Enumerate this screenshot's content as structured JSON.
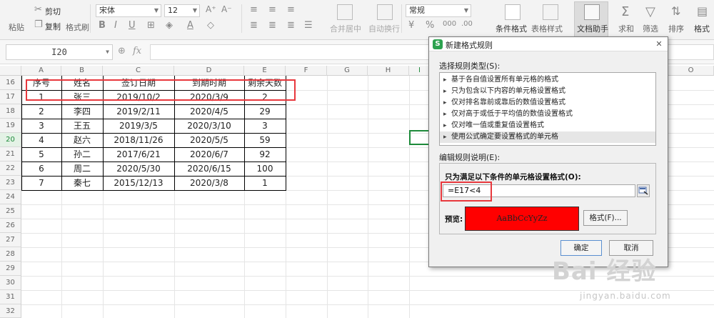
{
  "ribbon": {
    "paste": "粘贴",
    "cut": "剪切",
    "copy": "复制",
    "format_painter": "格式刷",
    "font_name": "宋体",
    "font_size": "12",
    "merge_center": "合并居中",
    "auto_wrap": "自动换行",
    "number_format": "常规",
    "conditional_format": "条件格式",
    "table_style": "表格样式",
    "doc_assistant": "文档助手",
    "sum": "求和",
    "filter": "筛选",
    "sort": "排序",
    "format": "格式"
  },
  "formula_bar": {
    "cell_ref": "I20",
    "fx": "fx"
  },
  "columns": [
    "A",
    "B",
    "C",
    "D",
    "E",
    "F",
    "G",
    "H",
    "I",
    "O"
  ],
  "rows": [
    "16",
    "17",
    "18",
    "19",
    "20",
    "21",
    "22",
    "23",
    "24",
    "25",
    "26",
    "27",
    "28",
    "29",
    "30",
    "31",
    "32",
    "33",
    "34",
    "35"
  ],
  "table": {
    "headers": [
      "序号",
      "姓名",
      "签订日期",
      "到期时期",
      "剩余天数"
    ],
    "data": [
      [
        "1",
        "张三",
        "2019/10/2",
        "2020/3/9",
        "2"
      ],
      [
        "2",
        "李四",
        "2019/2/11",
        "2020/4/5",
        "29"
      ],
      [
        "3",
        "王五",
        "2019/3/5",
        "2020/3/10",
        "3"
      ],
      [
        "4",
        "赵六",
        "2018/11/26",
        "2020/5/5",
        "59"
      ],
      [
        "5",
        "孙二",
        "2017/6/21",
        "2020/6/7",
        "92"
      ],
      [
        "6",
        "周二",
        "2020/5/30",
        "2020/6/15",
        "100"
      ],
      [
        "7",
        "秦七",
        "2015/12/13",
        "2020/3/8",
        "1"
      ]
    ]
  },
  "dialog": {
    "title": "新建格式规则",
    "close": "✕",
    "select_type_label": "选择规则类型(S):",
    "rule_types": [
      "基于各自值设置所有单元格的格式",
      "只为包含以下内容的单元格设置格式",
      "仅对排名靠前或靠后的数值设置格式",
      "仅对高于或低于平均值的数值设置格式",
      "仅对唯一值或重复值设置格式",
      "使用公式确定要设置格式的单元格"
    ],
    "edit_label": "编辑规则说明(E):",
    "condition_label": "只为满足以下条件的单元格设置格式(O):",
    "formula": "=E17<4",
    "preview_label": "预览:",
    "preview_sample": "AaBbCcYyZz",
    "format_button": "格式(F)...",
    "ok_button": "确定",
    "cancel_button": "取消"
  },
  "watermark": {
    "text": "Bai 经验",
    "sub": "jingyan.baidu.com"
  },
  "colors": {
    "selection_green": "#1d8a3a",
    "highlight_red": "#e8383d",
    "preview_fill": "#ff0000",
    "dialog_logo": "#2ca24f"
  }
}
